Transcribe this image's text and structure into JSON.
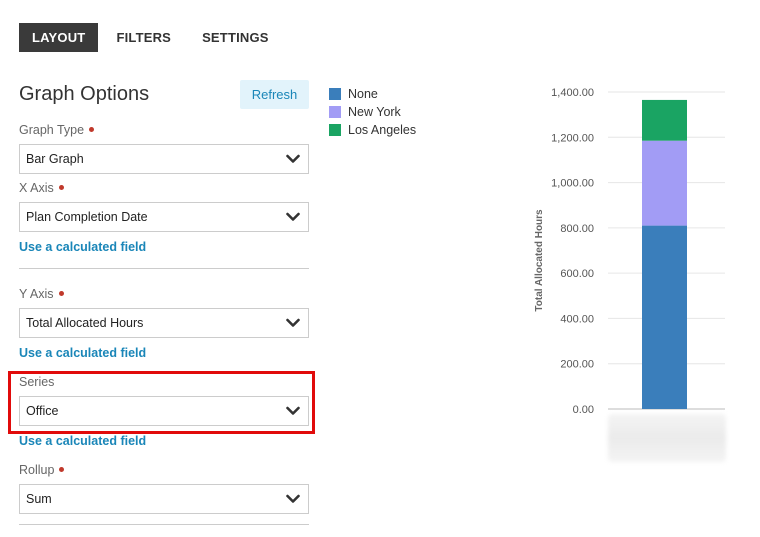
{
  "tabs": [
    {
      "label": "LAYOUT",
      "active": true
    },
    {
      "label": "FILTERS",
      "active": false
    },
    {
      "label": "SETTINGS",
      "active": false
    }
  ],
  "panel": {
    "title": "Graph Options",
    "refresh_label": "Refresh",
    "calc_link_label": "Use a calculated field",
    "graph_type": {
      "label": "Graph Type",
      "required": true,
      "value": "Bar Graph"
    },
    "x_axis": {
      "label": "X Axis",
      "required": true,
      "value": "Plan Completion Date"
    },
    "y_axis": {
      "label": "Y Axis",
      "required": true,
      "value": "Total Allocated Hours"
    },
    "series": {
      "label": "Series",
      "required": false,
      "value": "Office"
    },
    "rollup": {
      "label": "Rollup",
      "required": true,
      "value": "Sum"
    }
  },
  "colors": {
    "accent_link": "#1a86b8",
    "required_dot": "#c0392b",
    "highlight_box": "#e10b0b"
  },
  "chart_data": {
    "type": "bar",
    "stacked": true,
    "categories": [
      ""
    ],
    "series": [
      {
        "name": "None",
        "color": "#3a7ebb",
        "values": [
          810
        ]
      },
      {
        "name": "New York",
        "color": "#a29cf5",
        "values": [
          375
        ]
      },
      {
        "name": "Los Angeles",
        "color": "#1aa463",
        "values": [
          180
        ]
      }
    ],
    "ylabel": "Total Allocated Hours",
    "ylim": [
      0,
      1400
    ],
    "yticks": [
      0,
      200,
      400,
      600,
      800,
      1000,
      1200,
      1400
    ],
    "ytick_labels": [
      "0.00",
      "200.00",
      "400.00",
      "600.00",
      "800.00",
      "1,000.00",
      "1,200.00",
      "1,400.00"
    ],
    "grid": true,
    "legend_position": "top-left"
  }
}
